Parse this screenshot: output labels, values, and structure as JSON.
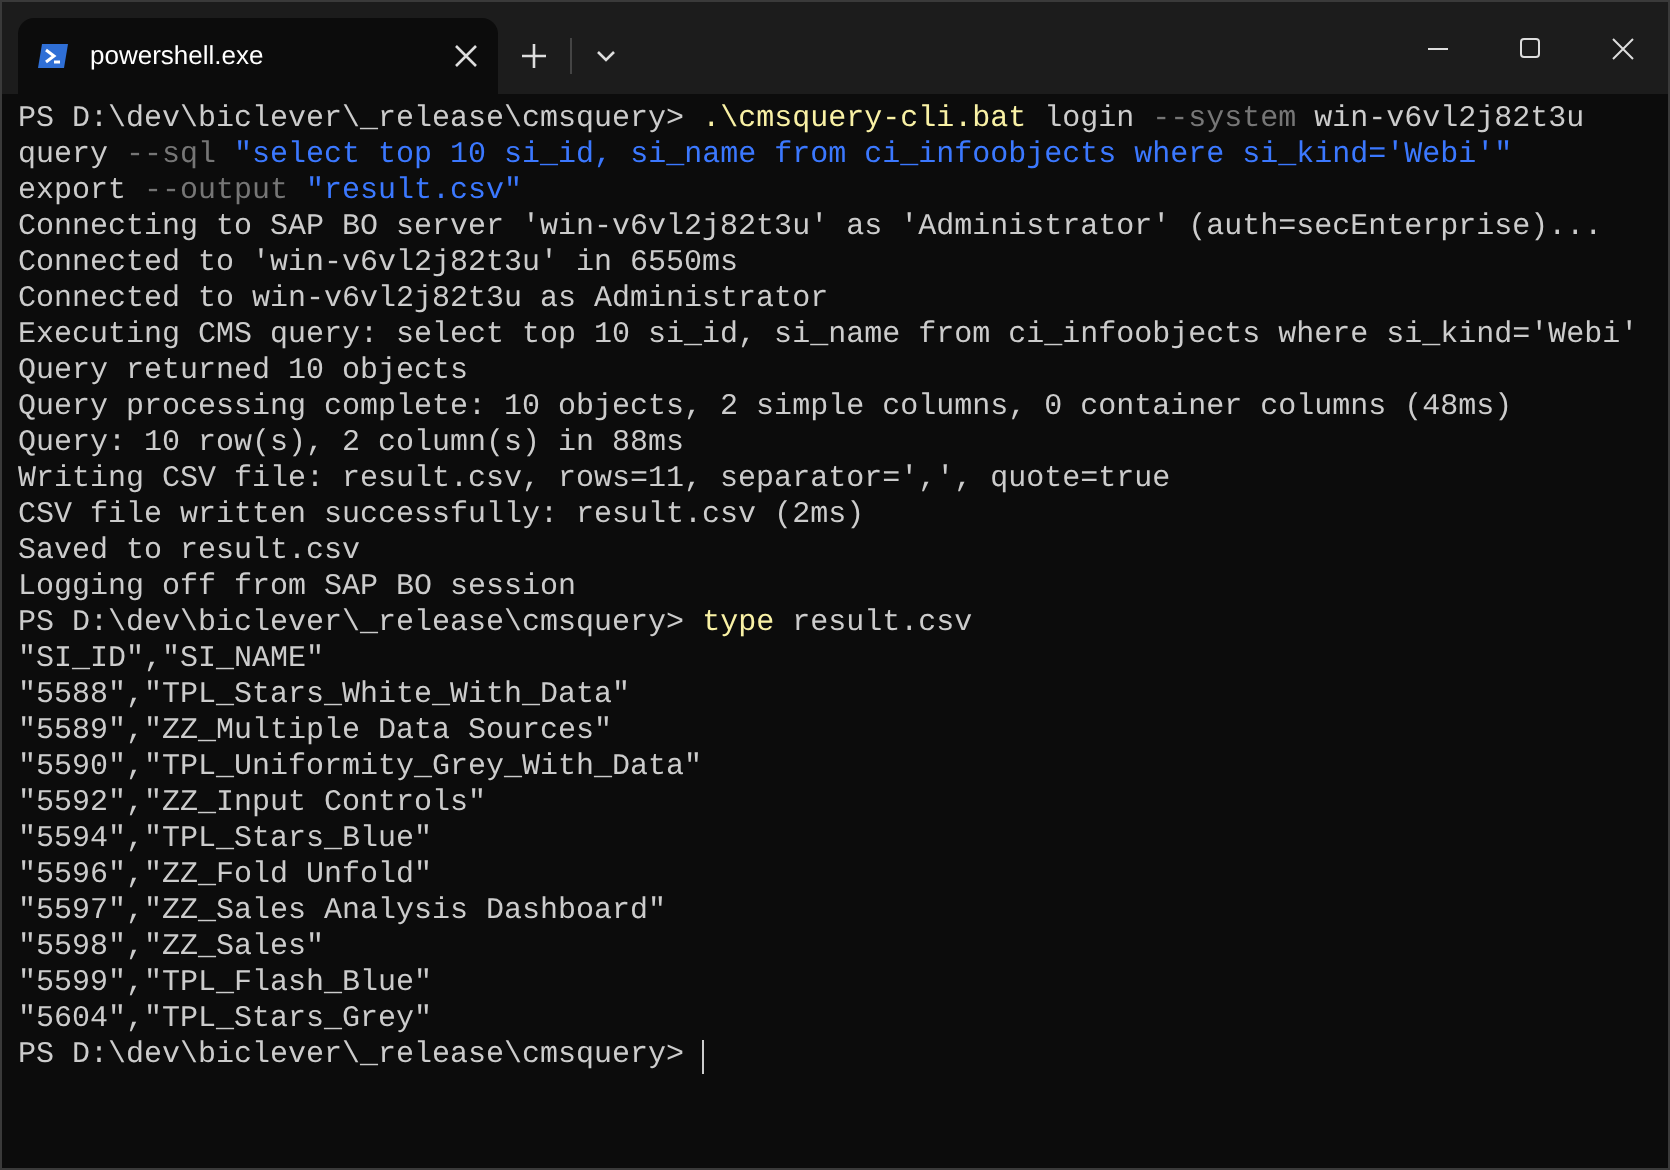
{
  "tab": {
    "title": "powershell.exe"
  },
  "lines": [
    [
      {
        "kind": "plain",
        "text": "PS D:\\dev\\biclever\\_release\\cmsquery> "
      },
      {
        "kind": "command",
        "text": ".\\cmsquery-cli.bat"
      },
      {
        "kind": "plain",
        "text": " login "
      },
      {
        "kind": "flag",
        "text": "--system"
      },
      {
        "kind": "plain",
        "text": " win-v6vl2j82t3u"
      }
    ],
    [
      {
        "kind": "plain",
        "text": "query "
      },
      {
        "kind": "flag",
        "text": "--sql "
      },
      {
        "kind": "string",
        "text": "\"select top 10 si_id, si_name from ci_infoobjects where si_kind='Webi'\""
      }
    ],
    [
      {
        "kind": "plain",
        "text": "export "
      },
      {
        "kind": "flag",
        "text": "--output "
      },
      {
        "kind": "string",
        "text": "\"result.csv\""
      }
    ],
    [
      {
        "kind": "plain",
        "text": "Connecting to SAP BO server 'win-v6vl2j82t3u' as 'Administrator' (auth=secEnterprise)..."
      }
    ],
    [
      {
        "kind": "plain",
        "text": "Connected to 'win-v6vl2j82t3u' in 6550ms"
      }
    ],
    [
      {
        "kind": "plain",
        "text": "Connected to win-v6vl2j82t3u as Administrator"
      }
    ],
    [
      {
        "kind": "plain",
        "text": "Executing CMS query: select top 10 si_id, si_name from ci_infoobjects where si_kind='Webi'"
      }
    ],
    [
      {
        "kind": "plain",
        "text": "Query returned 10 objects"
      }
    ],
    [
      {
        "kind": "plain",
        "text": "Query processing complete: 10 objects, 2 simple columns, 0 container columns (48ms)"
      }
    ],
    [
      {
        "kind": "plain",
        "text": "Query: 10 row(s), 2 column(s) in 88ms"
      }
    ],
    [
      {
        "kind": "plain",
        "text": "Writing CSV file: result.csv, rows=11, separator=',', quote=true"
      }
    ],
    [
      {
        "kind": "plain",
        "text": "CSV file written successfully: result.csv (2ms)"
      }
    ],
    [
      {
        "kind": "plain",
        "text": "Saved to result.csv"
      }
    ],
    [
      {
        "kind": "plain",
        "text": "Logging off from SAP BO session"
      }
    ],
    [
      {
        "kind": "plain",
        "text": "PS D:\\dev\\biclever\\_release\\cmsquery> "
      },
      {
        "kind": "command",
        "text": "type"
      },
      {
        "kind": "plain",
        "text": " result.csv"
      }
    ],
    [
      {
        "kind": "plain",
        "text": "\"SI_ID\",\"SI_NAME\""
      }
    ],
    [
      {
        "kind": "plain",
        "text": "\"5588\",\"TPL_Stars_White_With_Data\""
      }
    ],
    [
      {
        "kind": "plain",
        "text": "\"5589\",\"ZZ_Multiple Data Sources\""
      }
    ],
    [
      {
        "kind": "plain",
        "text": "\"5590\",\"TPL_Uniformity_Grey_With_Data\""
      }
    ],
    [
      {
        "kind": "plain",
        "text": "\"5592\",\"ZZ_Input Controls\""
      }
    ],
    [
      {
        "kind": "plain",
        "text": "\"5594\",\"TPL_Stars_Blue\""
      }
    ],
    [
      {
        "kind": "plain",
        "text": "\"5596\",\"ZZ_Fold Unfold\""
      }
    ],
    [
      {
        "kind": "plain",
        "text": "\"5597\",\"ZZ_Sales Analysis Dashboard\""
      }
    ],
    [
      {
        "kind": "plain",
        "text": "\"5598\",\"ZZ_Sales\""
      }
    ],
    [
      {
        "kind": "plain",
        "text": "\"5599\",\"TPL_Flash_Blue\""
      }
    ],
    [
      {
        "kind": "plain",
        "text": "\"5604\",\"TPL_Stars_Grey\""
      }
    ],
    [
      {
        "kind": "plain",
        "text": "PS D:\\dev\\biclever\\_release\\cmsquery> "
      }
    ]
  ]
}
